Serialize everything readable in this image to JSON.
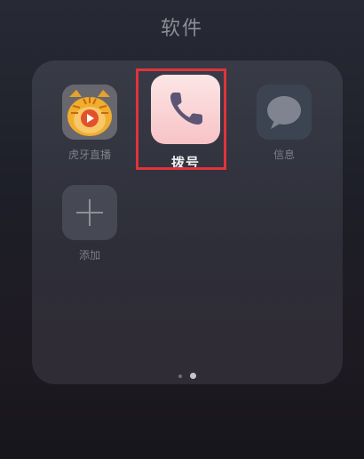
{
  "folder": {
    "title": "软件"
  },
  "apps": [
    {
      "label": "虎牙直播",
      "icon": "huya-tiger-icon"
    },
    {
      "label": "拨号",
      "icon": "phone-icon",
      "selected": true
    },
    {
      "label": "信息",
      "icon": "message-bubble-icon"
    },
    {
      "label": "添加",
      "icon": "plus-icon"
    }
  ],
  "pager": {
    "page_count": 2,
    "current_page": 2
  },
  "colors": {
    "highlight": "#e0333b",
    "dialer_bg": "#f7c3c6",
    "phone_glyph": "#5c5575"
  }
}
